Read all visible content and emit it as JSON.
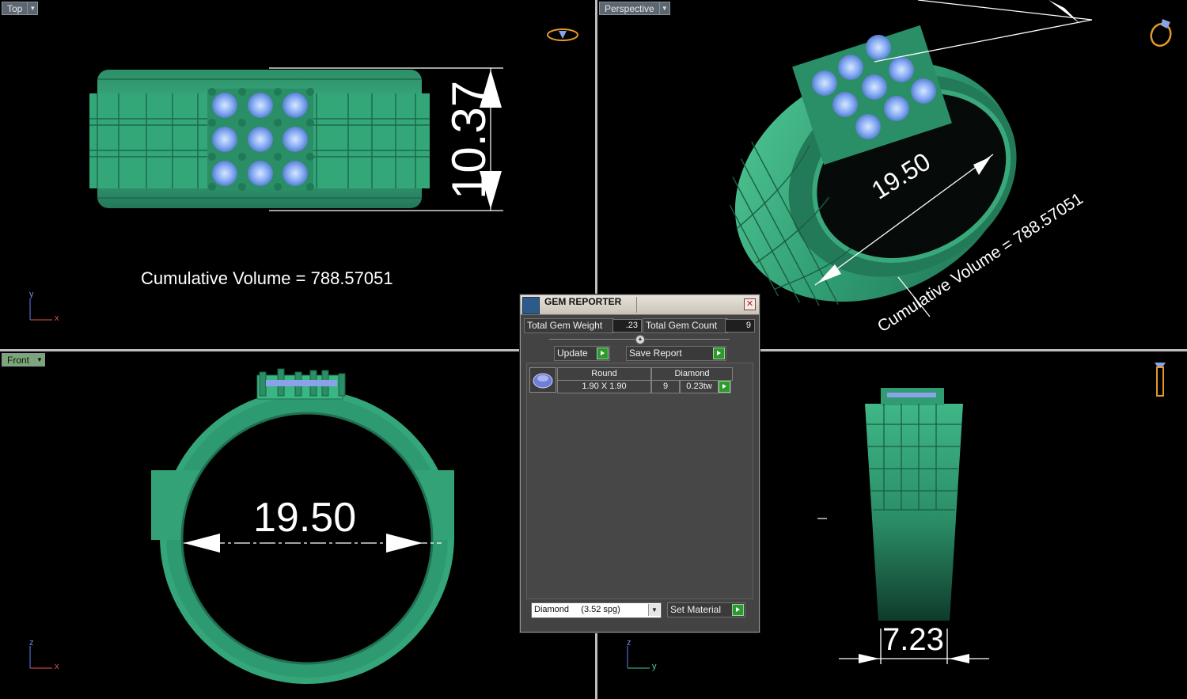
{
  "viewports": {
    "top": {
      "label": "Top",
      "cumulative_volume": "Cumulative Volume = 788.57051",
      "dimension": "10.37",
      "axis_a": "y",
      "axis_b": "x"
    },
    "perspective": {
      "label": "Perspective",
      "cumulative_volume": "Cumulative Volume = 788.57051",
      "dimension": "19.50"
    },
    "front": {
      "label": "Front",
      "dimension": "19.50",
      "axis_a": "z",
      "axis_b": "x"
    },
    "right": {
      "dimension": "7.23",
      "axis_a": "z",
      "axis_b": "y"
    }
  },
  "gem_reporter": {
    "title": "GEM REPORTER",
    "total_gem_weight_label": "Total Gem Weight",
    "total_gem_weight_value": ".23",
    "total_gem_count_label": "Total Gem Count",
    "total_gem_count_value": "9",
    "update_label": "Update",
    "save_report_label": "Save Report",
    "gems": [
      {
        "shape": "Round",
        "material": "Diamond",
        "size": "1.90 X 1.90",
        "count": "9",
        "weight": "0.23tw"
      }
    ],
    "material_select": "Diamond     (3.52 spg)",
    "set_material_label": "Set Material"
  },
  "colors": {
    "metal": "#2f9c72",
    "metal_light": "#5fd3a2",
    "gem": "#7fa9f2",
    "background": "#000000"
  }
}
